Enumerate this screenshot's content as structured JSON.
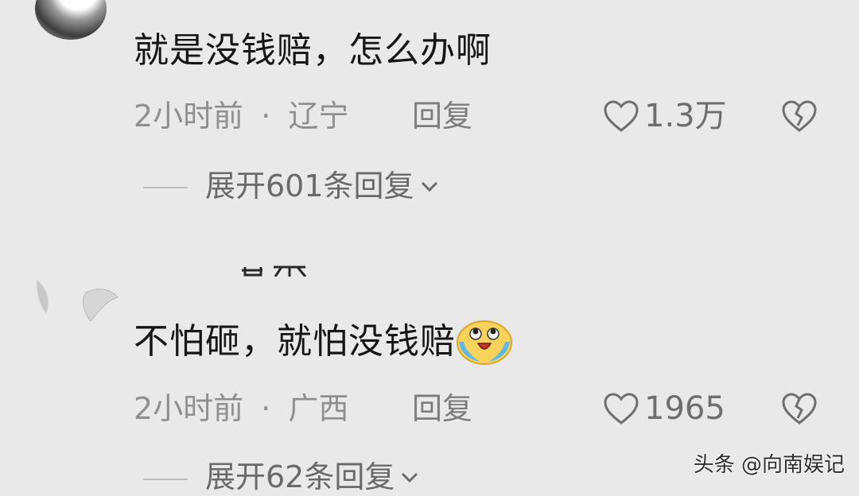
{
  "comments": [
    {
      "text": "就是没钱赔，怎么办啊",
      "time": "2小时前",
      "sep": "·",
      "location": "辽宁",
      "reply_label": "回复",
      "likes": "1.3万",
      "expand_label": "展开601条回复"
    },
    {
      "text": "不怕砸，就怕没钱赔",
      "emoji": "crying-laughing-emoji",
      "time": "2小时前",
      "sep": "·",
      "location": "广西",
      "reply_label": "回复",
      "likes": "1965",
      "expand_label": "展开62条回复"
    }
  ],
  "watermark": "头条 @向南娱记",
  "colors": {
    "background": "#e9e9e9",
    "text": "#161616",
    "meta": "#8f8f8f",
    "icon": "#6e6e6e"
  }
}
